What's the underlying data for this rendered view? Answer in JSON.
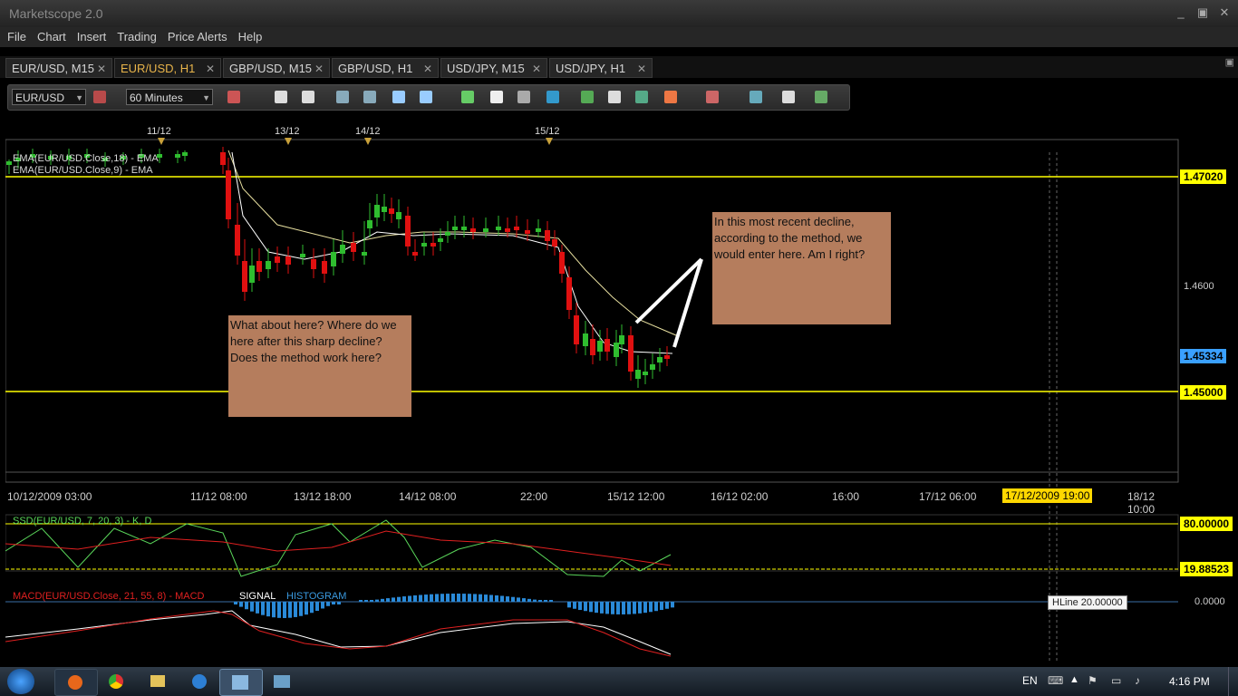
{
  "window": {
    "title": "Marketscope 2.0",
    "buttons": {
      "minimize": "_",
      "restore": "▣",
      "close": "✕"
    }
  },
  "menu": [
    "File",
    "Chart",
    "Insert",
    "Trading",
    "Price Alerts",
    "Help"
  ],
  "tabs": [
    {
      "label": "EUR/USD, M15",
      "active": false
    },
    {
      "label": "EUR/USD, H1",
      "active": true
    },
    {
      "label": "GBP/USD, M15",
      "active": false
    },
    {
      "label": "GBP/USD, H1",
      "active": false
    },
    {
      "label": "USD/JPY, M15",
      "active": false
    },
    {
      "label": "USD/JPY, H1",
      "active": false
    }
  ],
  "toolbar": {
    "symbol": "EUR/USD",
    "timeframe": "60 Minutes"
  },
  "chart": {
    "top_dates": [
      "11/12",
      "13/12",
      "14/12",
      "15/12"
    ],
    "ema_legend_1": "EMA(EUR/USD.Close,18) - EMA",
    "ema_legend_2": "EMA(EUR/USD.Close,9) - EMA",
    "prices": {
      "p1": "1.47020",
      "p2": "1.4600",
      "p3": "1.45334",
      "p4": "1.45000"
    },
    "x_axis": [
      "10/12/2009 03:00",
      "11/12 08:00",
      "13/12 18:00",
      "14/12 08:00",
      "22:00",
      "15/12 12:00",
      "16/12 02:00",
      "16:00",
      "17/12 06:00",
      "17/12/2009 19:00",
      "18/12 10:00"
    ],
    "note_left": "What about here? Where do we here after this sharp decline? Does the method work here?",
    "note_right": "In this most recent decline, according to the method, we would enter here. Am I right?"
  },
  "ssd": {
    "legend": "SSD(EUR/USD, 7, 20, 3) - K, D",
    "upper": "80.00000",
    "lower": "19.88523"
  },
  "macd": {
    "legend_main": "MACD(EUR/USD.Close, 21, 55, 8) - MACD",
    "legend_signal": "SIGNAL",
    "legend_hist": "HISTOGRAM",
    "zero": "0.0000",
    "hline_tip": "HLine 20.00000"
  },
  "colors": {
    "accent": "#e8b44a",
    "hline": "#ffff00",
    "bull": "#2fbd2f",
    "bear": "#e01010",
    "note_bg": "#b57d5d",
    "price_blue": "#3aa0ff"
  },
  "taskbar": {
    "lang": "EN",
    "time": "4:16 PM"
  }
}
